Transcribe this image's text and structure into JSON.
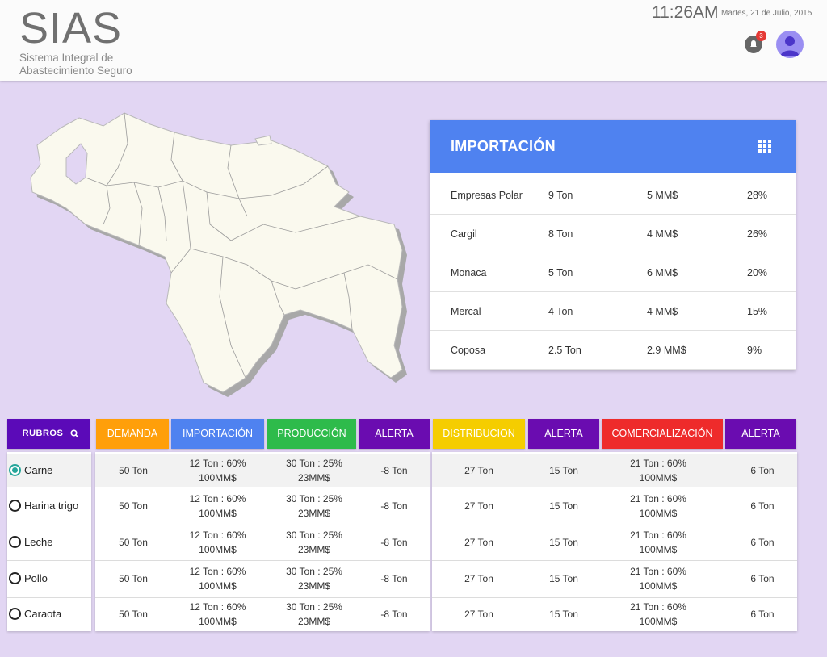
{
  "header": {
    "logo": "SIAS",
    "subtitle": "Sistema Integral de Abastecimiento Seguro",
    "time": "11:26AM",
    "date": "Martes, 21 de Julio, 2015",
    "notification_count": "3",
    "bell_icon": "bell-icon",
    "avatar_icon": "user-avatar-icon"
  },
  "map": {
    "icon": "venezuela-map"
  },
  "importacion": {
    "title": "IMPORTACIÓN",
    "menu_icon": "grid-apps-icon",
    "rows": [
      {
        "company": "Empresas Polar",
        "tons": "9 Ton",
        "amount": "5 MM$",
        "percent": "28%"
      },
      {
        "company": "Cargil",
        "tons": "8 Ton",
        "amount": "4 MM$",
        "percent": "26%"
      },
      {
        "company": "Monaca",
        "tons": "5 Ton",
        "amount": "6 MM$",
        "percent": "20%"
      },
      {
        "company": "Mercal",
        "tons": "4 Ton",
        "amount": "4 MM$",
        "percent": "15%"
      },
      {
        "company": "Coposa",
        "tons": "2.5 Ton",
        "amount": "2.9 MM$",
        "percent": "9%"
      }
    ]
  },
  "table": {
    "rubros_label": "RUBROS",
    "search_icon": "search-icon",
    "headers": [
      {
        "label": "DEMANDA",
        "color": "#ff9f0a"
      },
      {
        "label": "IMPORTACIÓN",
        "color": "#4f82f0"
      },
      {
        "label": "PRODUCCIÓN",
        "color": "#2ebb4b"
      },
      {
        "label": "ALERTA",
        "color": "#6a0cb0"
      },
      {
        "label": "DISTRIBUCION",
        "color": "#f5cd00"
      },
      {
        "label": "ALERTA",
        "color": "#6a0cb0"
      },
      {
        "label": "COMERCIALIZACIÓN",
        "color": "#ee2b2b"
      },
      {
        "label": "ALERTA",
        "color": "#6a0cb0"
      }
    ],
    "rubros_color": "#5b0ab8",
    "selected_index": 0,
    "rows": [
      {
        "name": "Carne",
        "demanda": "50 Ton",
        "importacion_1": "12 Ton : 60%",
        "importacion_2": "100MM$",
        "produccion_1": "30 Ton : 25%",
        "produccion_2": "23MM$",
        "alerta1": "-8 Ton",
        "distribucion": "27 Ton",
        "alerta2": "15 Ton",
        "comercializacion_1": "21 Ton : 60%",
        "comercializacion_2": "100MM$",
        "alerta3": "6 Ton"
      },
      {
        "name": "Harina trigo",
        "demanda": "50 Ton",
        "importacion_1": "12 Ton : 60%",
        "importacion_2": "100MM$",
        "produccion_1": "30 Ton : 25%",
        "produccion_2": "23MM$",
        "alerta1": "-8 Ton",
        "distribucion": "27 Ton",
        "alerta2": "15 Ton",
        "comercializacion_1": "21 Ton : 60%",
        "comercializacion_2": "100MM$",
        "alerta3": "6 Ton"
      },
      {
        "name": "Leche",
        "demanda": "50 Ton",
        "importacion_1": "12 Ton : 60%",
        "importacion_2": "100MM$",
        "produccion_1": "30 Ton : 25%",
        "produccion_2": "23MM$",
        "alerta1": "-8 Ton",
        "distribucion": "27 Ton",
        "alerta2": "15 Ton",
        "comercializacion_1": "21 Ton : 60%",
        "comercializacion_2": "100MM$",
        "alerta3": "6 Ton"
      },
      {
        "name": "Pollo",
        "demanda": "50 Ton",
        "importacion_1": "12 Ton : 60%",
        "importacion_2": "100MM$",
        "produccion_1": "30 Ton : 25%",
        "produccion_2": "23MM$",
        "alerta1": "-8 Ton",
        "distribucion": "27 Ton",
        "alerta2": "15 Ton",
        "comercializacion_1": "21 Ton : 60%",
        "comercializacion_2": "100MM$",
        "alerta3": "6 Ton"
      },
      {
        "name": "Caraota",
        "demanda": "50 Ton",
        "importacion_1": "12 Ton : 60%",
        "importacion_2": "100MM$",
        "produccion_1": "30 Ton : 25%",
        "produccion_2": "23MM$",
        "alerta1": "-8 Ton",
        "distribucion": "27 Ton",
        "alerta2": "15 Ton",
        "comercializacion_1": "21 Ton : 60%",
        "comercializacion_2": "100MM$",
        "alerta3": "6 Ton"
      }
    ]
  }
}
